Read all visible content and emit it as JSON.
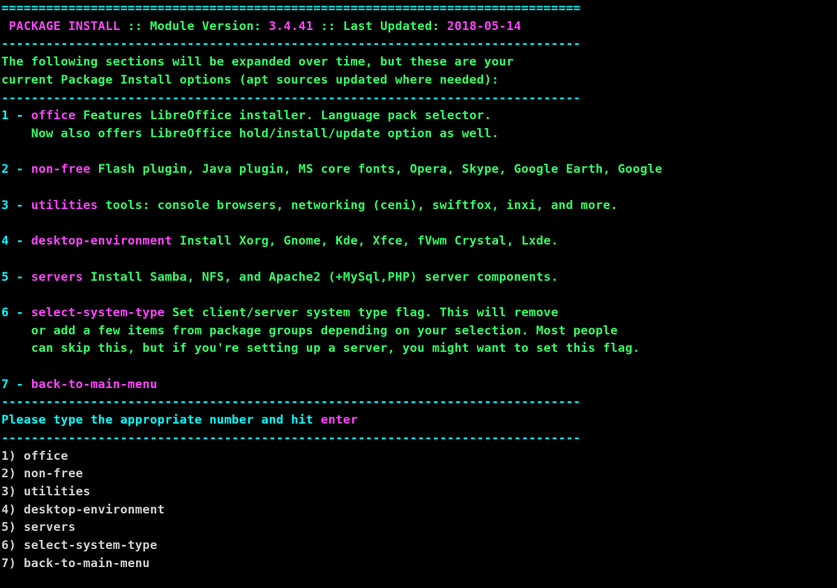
{
  "rule": "==============================================================================",
  "dash": "------------------------------------------------------------------------------",
  "header": {
    "title": " PACKAGE INSTALL ",
    "sep": ":: ",
    "module_label": "Module Version:",
    "module_version": " 3.4.41 ",
    "updated_label": "Last Updated:",
    "updated_value": " 2018-05-14"
  },
  "intro": {
    "l1": "The following sections will be expanded over time, but these are your",
    "l2": "current Package Install options (apt sources updated where needed):"
  },
  "items": [
    {
      "num": "1 - ",
      "name": "office ",
      "desc_l1": "Features LibreOffice installer. Language pack selector.",
      "desc_l2": "    Now also offers LibreOffice hold/install/update option as well."
    },
    {
      "num": "2 - ",
      "name": "non-free ",
      "desc_l1": "Flash plugin, Java plugin, MS core fonts, Opera, Skype, Google Earth, Google"
    },
    {
      "num": "3 - ",
      "name": "utilities ",
      "desc_l1": "tools: console browsers, networking (ceni), swiftfox, inxi, and more."
    },
    {
      "num": "4 - ",
      "name": "desktop-environment ",
      "desc_l1": "Install Xorg, Gnome, Kde, Xfce, fVwm Crystal, Lxde."
    },
    {
      "num": "5 - ",
      "name": "servers ",
      "desc_l1": "Install Samba, NFS, and Apache2 (+MySql,PHP) server components."
    },
    {
      "num": "6 - ",
      "name": "select-system-type ",
      "desc_l1": "Set client/server system type flag. This will remove",
      "desc_l2": "    or add a few items from package groups depending on your selection. Most people",
      "desc_l3": "    can skip this, but if you're setting up a server, you might want to set this flag."
    },
    {
      "num": "7 - ",
      "name": "back-to-main-menu"
    }
  ],
  "prompt": {
    "pre": "Please type the appropriate number and hit ",
    "enter": "enter"
  },
  "options": [
    "1) office",
    "2) non-free",
    "3) utilities",
    "4) desktop-environment",
    "5) servers",
    "6) select-system-type",
    "7) back-to-main-menu"
  ]
}
